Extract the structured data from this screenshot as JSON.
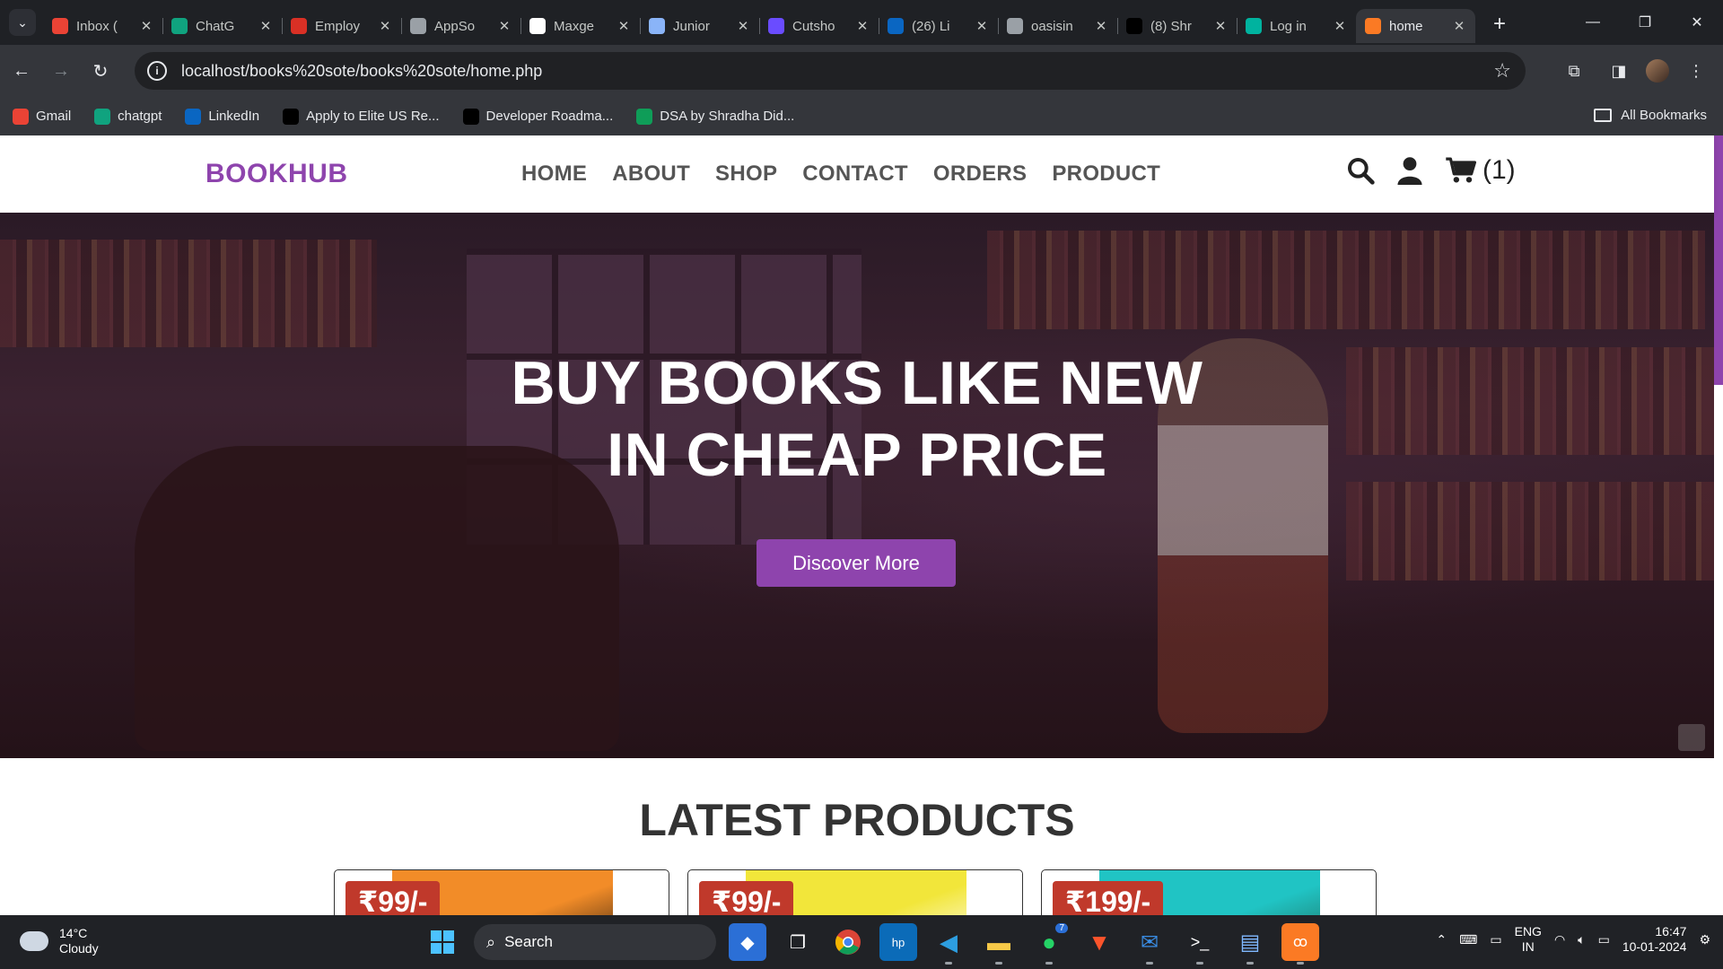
{
  "browser": {
    "tabs": [
      {
        "title": "Inbox (",
        "favicon": "gmail-icon",
        "color": "#ea4335",
        "active": false
      },
      {
        "title": "ChatG",
        "favicon": "chatgpt-icon",
        "color": "#10a37f",
        "active": false
      },
      {
        "title": "Employ",
        "favicon": "employ-icon",
        "color": "#d93025",
        "active": false
      },
      {
        "title": "AppSo",
        "favicon": "globe-icon",
        "color": "#9aa0a6",
        "active": false
      },
      {
        "title": "Maxge",
        "favicon": "maxgen-icon",
        "color": "#ffffff",
        "active": false
      },
      {
        "title": "Junior",
        "favicon": "junior-icon",
        "color": "#8ab4f8",
        "active": false
      },
      {
        "title": "Cutsho",
        "favicon": "cutshort-icon",
        "color": "#6a4cff",
        "active": false
      },
      {
        "title": "(26) Li",
        "favicon": "linkedin-icon",
        "color": "#0a66c2",
        "active": false
      },
      {
        "title": "oasisin",
        "favicon": "globe-icon",
        "color": "#9aa0a6",
        "active": false
      },
      {
        "title": "(8) Shr",
        "favicon": "x-icon",
        "color": "#000000",
        "active": false
      },
      {
        "title": "Log in",
        "favicon": "diamond-icon",
        "color": "#00b39f",
        "active": false
      },
      {
        "title": "home",
        "favicon": "xampp-icon",
        "color": "#fb7a24",
        "active": true
      }
    ],
    "url": "localhost/books%20sote/books%20sote/home.php",
    "bookmarks": [
      {
        "label": "Gmail",
        "favicon": "gmail-icon",
        "color": "#ea4335"
      },
      {
        "label": "chatgpt",
        "favicon": "chatgpt-icon",
        "color": "#10a37f"
      },
      {
        "label": "LinkedIn",
        "favicon": "linkedin-icon",
        "color": "#0a66c2"
      },
      {
        "label": "Apply to Elite US Re...",
        "favicon": "turing-icon",
        "color": "#000000"
      },
      {
        "label": "Developer Roadma...",
        "favicon": "roadmap-icon",
        "color": "#000000"
      },
      {
        "label": "DSA by Shradha Did...",
        "favicon": "sheets-icon",
        "color": "#0f9d58"
      }
    ],
    "all_bookmarks": "All Bookmarks"
  },
  "site": {
    "logo": "BOOKHUB",
    "nav": [
      "HOME",
      "ABOUT",
      "SHOP",
      "CONTACT",
      "ORDERS",
      "PRODUCT"
    ],
    "cart_count": "(1)",
    "accent": "#8e44ad",
    "hero": {
      "title_line1": "BUY BOOKS LIKE NEW",
      "title_line2": "IN CHEAP PRICE",
      "button": "Discover More"
    },
    "latest_title": "LATEST PRODUCTS",
    "products": [
      {
        "price": "₹99/-",
        "image_colors": [
          "#f28c28",
          "#2b1a0e"
        ]
      },
      {
        "price": "₹99/-",
        "image_colors": [
          "#f2e63a",
          "#ffffff"
        ]
      },
      {
        "price": "₹199/-",
        "image_colors": [
          "#20c4c4",
          "#1e6a5a"
        ]
      }
    ]
  },
  "taskbar": {
    "weather_temp": "14°C",
    "weather_desc": "Cloudy",
    "search_label": "Search",
    "lang_top": "ENG",
    "lang_bottom": "IN",
    "time": "16:47",
    "date": "10-01-2024",
    "whatsapp_badge": "7"
  }
}
